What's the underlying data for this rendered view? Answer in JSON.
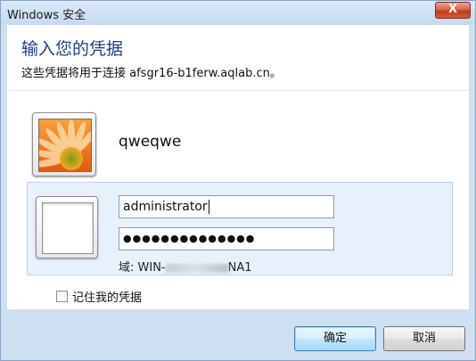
{
  "window": {
    "title": "Windows 安全",
    "close_label": "X"
  },
  "header": {
    "title": "输入您的凭据",
    "subtitle": "这些凭据将用于连接 afsgr16-b1ferw.aqlab.cn。"
  },
  "saved_user": {
    "name": "qweqwe"
  },
  "credentials": {
    "username_value": "administrator",
    "password_mask": "●●●●●●●●●●●●●●",
    "domain_prefix": "域: WIN-",
    "domain_suffix": "NA1"
  },
  "options": {
    "remember_label": "记住我的凭据",
    "remember_checked": false
  },
  "buttons": {
    "ok_label": "确定",
    "cancel_label": "取消"
  }
}
